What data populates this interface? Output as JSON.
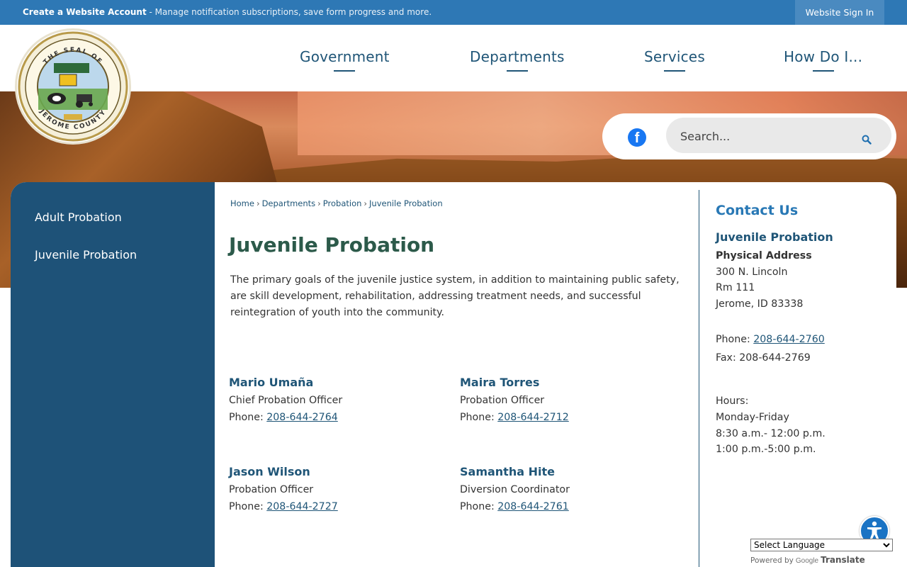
{
  "topbar": {
    "create_account_bold": "Create a Website Account",
    "create_account_rest": " - Manage notification subscriptions, save form progress and more.",
    "signin_label": "Website Sign In"
  },
  "seal": {
    "text_top": "THE SEAL OF",
    "text_bottom": "JEROME COUNTY"
  },
  "nav": {
    "items": [
      "Government",
      "Departments",
      "Services",
      "How Do I..."
    ]
  },
  "search": {
    "placeholder": "Search..."
  },
  "sidebar": {
    "items": [
      "Adult Probation",
      "Juvenile Probation"
    ]
  },
  "breadcrumb": {
    "items": [
      "Home",
      "Departments",
      "Probation",
      "Juvenile Probation"
    ],
    "separator": "›"
  },
  "main": {
    "title": "Juvenile Probation",
    "intro": "The primary goals of the juvenile justice system, in addition to maintaining public safety, are skill development, rehabilitation, addressing treatment needs, and successful reintegration of youth into the community.",
    "phone_label": "Phone: ",
    "staff": [
      {
        "name": "Mario Umaña",
        "role": "Chief Probation Officer",
        "phone": "208-644-2764"
      },
      {
        "name": "Maira Torres",
        "role": "Probation Officer",
        "phone": "208-644-2712"
      },
      {
        "name": "Jason Wilson",
        "role": "Probation Officer",
        "phone": "208-644-2727"
      },
      {
        "name": "Samantha Hite",
        "role": "Diversion Coordinator",
        "phone": "208-644-2761"
      }
    ]
  },
  "contact": {
    "heading": "Contact Us",
    "department": "Juvenile Probation",
    "address_label": "Physical Address",
    "address_lines": [
      "300 N. Lincoln",
      "Rm 111",
      "Jerome, ID 83338"
    ],
    "phone_label": "Phone: ",
    "phone": "208-644-2760",
    "fax": "Fax: 208-644-2769",
    "hours_lines": [
      "Hours:",
      "Monday-Friday",
      "8:30 a.m.- 12:00 p.m.",
      "1:00 p.m.-5:00 p.m."
    ]
  },
  "translate": {
    "select_label": "Select Language",
    "powered_by": "Powered by",
    "google": "Google",
    "translate": "Translate"
  },
  "colors": {
    "topbar": "#2e78b5",
    "nav_text": "#1f5577",
    "sidebar": "#1e5278",
    "title": "#2c5a4a",
    "accent": "#2878b5"
  }
}
